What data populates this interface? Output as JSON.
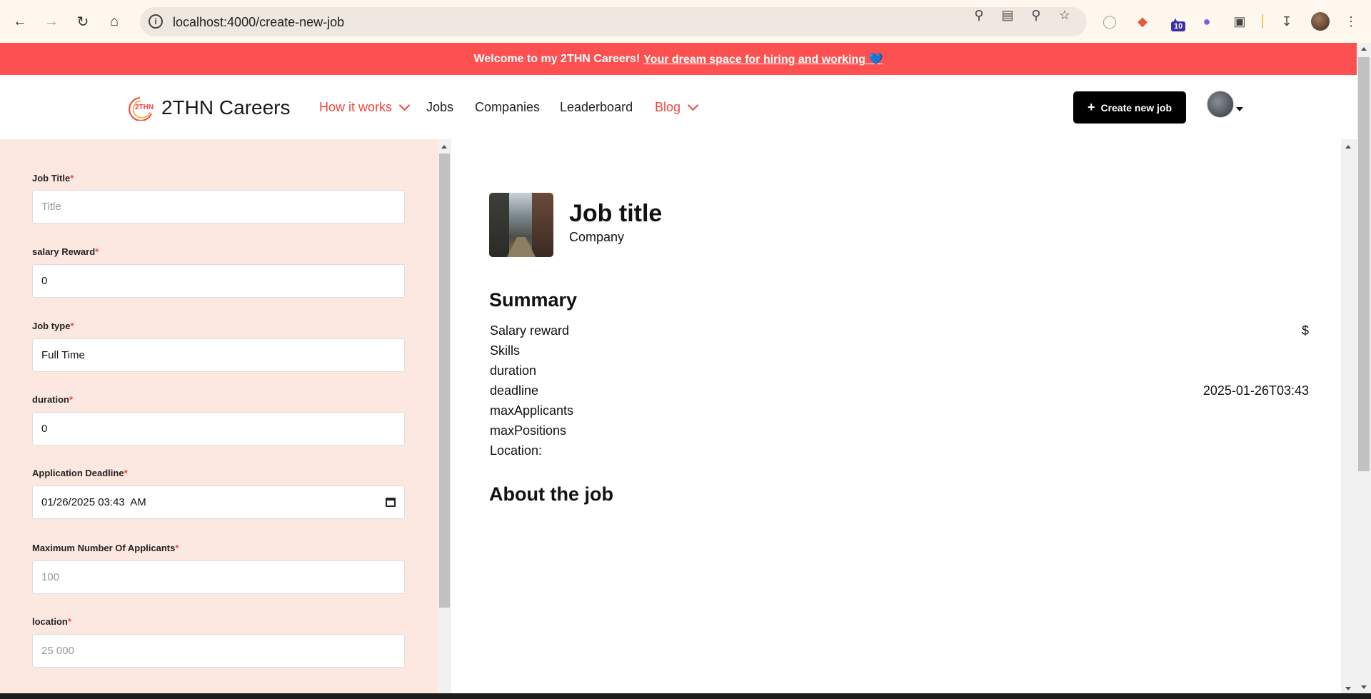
{
  "browser": {
    "url": "localhost:4000/create-new-job",
    "extension_badge": "10"
  },
  "banner": {
    "bold_text": "Welcome to my 2THN Careers!",
    "link_text": "Your dream space for hiring and working",
    "emoji": "💙"
  },
  "header": {
    "logo_text": "2THN Careers",
    "logo_mark": "2THN",
    "nav": [
      {
        "label": "How it works",
        "has_dropdown": true
      },
      {
        "label": "Jobs",
        "has_dropdown": false
      },
      {
        "label": "Companies",
        "has_dropdown": false
      },
      {
        "label": "Leaderboard",
        "has_dropdown": false
      },
      {
        "label": "Blog",
        "has_dropdown": true
      }
    ],
    "create_button": "Create new job",
    "create_button_icon": "+"
  },
  "form": {
    "fields": [
      {
        "label": "Job Title",
        "value": "",
        "placeholder": "Title"
      },
      {
        "label": "salary Reward",
        "value": "0",
        "placeholder": ""
      },
      {
        "label": "Job type",
        "value": "Full Time",
        "placeholder": ""
      },
      {
        "label": "duration",
        "value": "0",
        "placeholder": ""
      },
      {
        "label": "Application Deadline",
        "value": "01/26/2025 03:43  AM",
        "placeholder": ""
      },
      {
        "label": "Maximum Number Of Applicants",
        "value": "",
        "placeholder": "100"
      },
      {
        "label": "location",
        "value": "",
        "placeholder": "25 000"
      }
    ],
    "required_mark": "*"
  },
  "preview": {
    "job_title": "Job title",
    "company": "Company",
    "summary_heading": "Summary",
    "rows": [
      {
        "label": "Salary reward",
        "value": "$"
      },
      {
        "label": "Skills",
        "value": ""
      },
      {
        "label": "duration",
        "value": ""
      },
      {
        "label": "deadline",
        "value": "2025-01-26T03:43"
      },
      {
        "label": "maxApplicants",
        "value": ""
      },
      {
        "label": "maxPositions",
        "value": ""
      },
      {
        "label": "Location:",
        "value": ""
      }
    ],
    "about_heading": "About the job"
  },
  "colors": {
    "brand_red": "#fc5150",
    "accent_red": "#f0453e",
    "form_bg": "#fde8e1"
  }
}
